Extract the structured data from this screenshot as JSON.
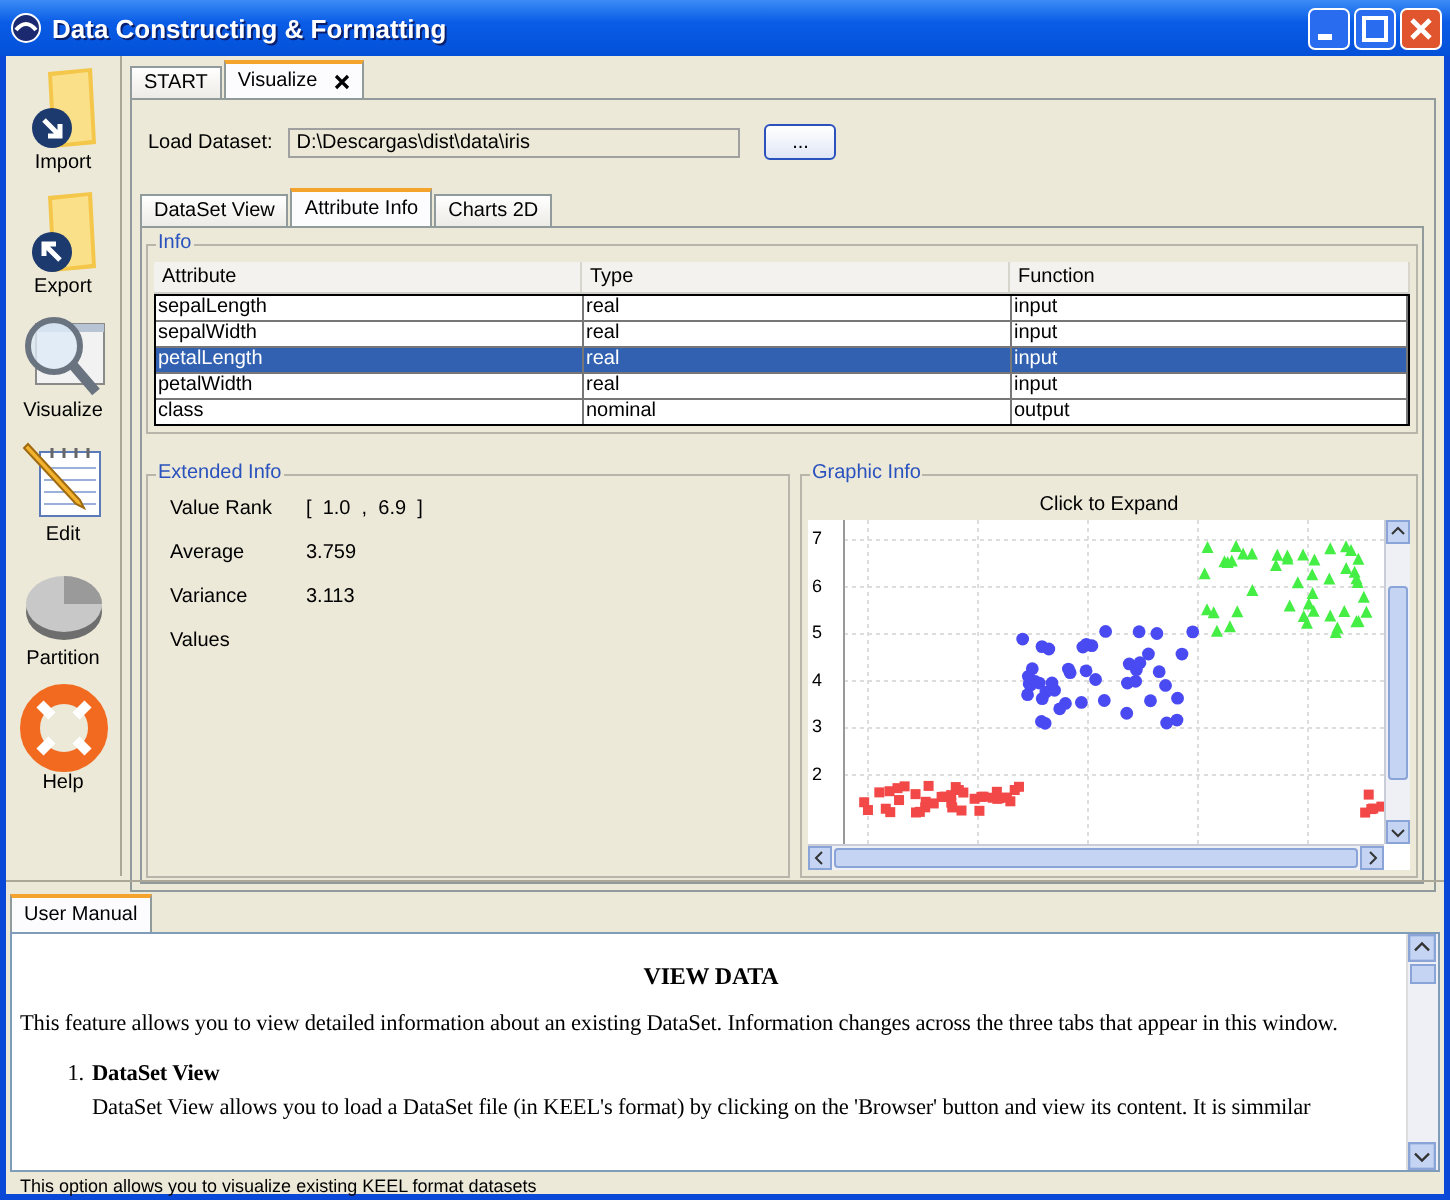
{
  "window": {
    "title": "Data Constructing & Formatting"
  },
  "sidebar": {
    "items": [
      {
        "label": "Import",
        "kind": "import"
      },
      {
        "label": "Export",
        "kind": "export"
      },
      {
        "label": "Visualize",
        "kind": "visualize"
      },
      {
        "label": "Edit",
        "kind": "edit"
      },
      {
        "label": "Partition",
        "kind": "partition"
      },
      {
        "label": "Help",
        "kind": "help"
      }
    ]
  },
  "main_tabs": [
    {
      "label": "START",
      "selected": false,
      "closable": false
    },
    {
      "label": "Visualize",
      "selected": true,
      "closable": true
    }
  ],
  "load_dataset": {
    "label": "Load Dataset:",
    "value": "D:\\Descargas\\dist\\data\\iris",
    "browse_button": "..."
  },
  "sub_tabs": [
    {
      "label": "DataSet View",
      "selected": false
    },
    {
      "label": "Attribute Info",
      "selected": true
    },
    {
      "label": "Charts 2D",
      "selected": false
    }
  ],
  "info": {
    "title": "Info",
    "columns": [
      "Attribute",
      "Type",
      "Function"
    ],
    "rows": [
      {
        "cells": [
          "sepalLength",
          "real",
          "input"
        ],
        "selected": false
      },
      {
        "cells": [
          "sepalWidth",
          "real",
          "input"
        ],
        "selected": false
      },
      {
        "cells": [
          "petalLength",
          "real",
          "input"
        ],
        "selected": true
      },
      {
        "cells": [
          "petalWidth",
          "real",
          "input"
        ],
        "selected": false
      },
      {
        "cells": [
          "class",
          "nominal",
          "output"
        ],
        "selected": false
      }
    ]
  },
  "extended_info": {
    "title": "Extended Info",
    "fields": [
      {
        "label": "Value Rank",
        "value": "[  1.0  ,  6.9  ]"
      },
      {
        "label": "Average",
        "value": "3.759"
      },
      {
        "label": "Variance",
        "value": "3.113"
      },
      {
        "label": "Values"
      }
    ]
  },
  "graphic_info": {
    "title": "Graphic Info",
    "caption": "Click to Expand",
    "y_ticks": [
      "7",
      "6",
      "5",
      "4",
      "3",
      "2"
    ]
  },
  "manual": {
    "tab": "User Manual",
    "heading": "VIEW DATA",
    "paragraph": "This feature allows you to view detailed information about an existing DataSet. Information changes across the three tabs that appear in this window.",
    "items": [
      {
        "number": "1.",
        "title": "DataSet View",
        "text": "DataSet View allows you to load a DataSet file (in KEEL's format) by clicking on the 'Browser' button and view its content. It is simmilar"
      }
    ]
  },
  "status_bar": {
    "text": "This option allows you to visualize existing KEEL format datasets"
  }
}
